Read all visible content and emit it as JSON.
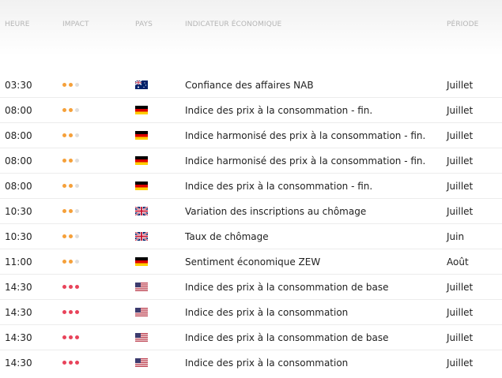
{
  "headers": {
    "time": "HEURE",
    "impact": "IMPACT",
    "country": "PAYS",
    "indicator": "INDICATEUR ÉCONOMIQUE",
    "period": "PÉRIODE"
  },
  "colors": {
    "medium": "#f5a03a",
    "high": "#e8435a",
    "empty": "#dedede"
  },
  "rows": [
    {
      "time": "03:30",
      "impact": 2,
      "country": "au",
      "indicator": "Confiance des affaires NAB",
      "period": "Juillet"
    },
    {
      "time": "08:00",
      "impact": 2,
      "country": "de",
      "indicator": "Indice des prix à la consommation - fin.",
      "period": "Juillet"
    },
    {
      "time": "08:00",
      "impact": 2,
      "country": "de",
      "indicator": "Indice harmonisé des prix à la consommation - fin.",
      "period": "Juillet"
    },
    {
      "time": "08:00",
      "impact": 2,
      "country": "de",
      "indicator": "Indice harmonisé des prix à la consommation - fin.",
      "period": "Juillet"
    },
    {
      "time": "08:00",
      "impact": 2,
      "country": "de",
      "indicator": "Indice des prix à la consommation - fin.",
      "period": "Juillet"
    },
    {
      "time": "10:30",
      "impact": 2,
      "country": "gb",
      "indicator": "Variation des inscriptions au chômage",
      "period": "Juillet"
    },
    {
      "time": "10:30",
      "impact": 2,
      "country": "gb",
      "indicator": "Taux de chômage",
      "period": "Juin"
    },
    {
      "time": "11:00",
      "impact": 2,
      "country": "de",
      "indicator": "Sentiment économique ZEW",
      "period": "Août"
    },
    {
      "time": "14:30",
      "impact": 3,
      "country": "us",
      "indicator": "Indice des prix à la consommation de base",
      "period": "Juillet"
    },
    {
      "time": "14:30",
      "impact": 3,
      "country": "us",
      "indicator": "Indice des prix à la consommation",
      "period": "Juillet"
    },
    {
      "time": "14:30",
      "impact": 3,
      "country": "us",
      "indicator": "Indice des prix à la consommation de base",
      "period": "Juillet"
    },
    {
      "time": "14:30",
      "impact": 3,
      "country": "us",
      "indicator": "Indice des prix à la consommation",
      "period": "Juillet"
    }
  ]
}
